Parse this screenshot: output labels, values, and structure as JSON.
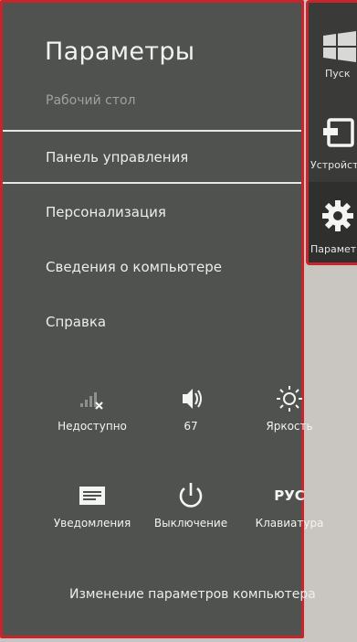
{
  "panel": {
    "title": "Параметры",
    "subtitle": "Рабочий стол",
    "menu": [
      {
        "label": "Панель управления"
      },
      {
        "label": "Персонализация"
      },
      {
        "label": "Сведения о компьютере"
      },
      {
        "label": "Справка"
      }
    ],
    "quick_settings": [
      {
        "label": "Недоступно",
        "icon": "network-unavailable-icon"
      },
      {
        "label": "67",
        "icon": "volume-icon"
      },
      {
        "label": "Яркость",
        "icon": "brightness-icon"
      },
      {
        "label": "Уведомления",
        "icon": "notifications-icon"
      },
      {
        "label": "Выключение",
        "icon": "power-icon"
      },
      {
        "label": "Клавиатура",
        "icon": "keyboard-icon",
        "icon_text": "РУС"
      }
    ],
    "footer_link": "Изменение параметров компьютера"
  },
  "charms": [
    {
      "label": "Пуск",
      "icon": "windows-start-icon"
    },
    {
      "label": "Устройства",
      "icon": "devices-icon"
    },
    {
      "label": "Параметры",
      "icon": "gear-icon",
      "selected": true
    }
  ],
  "colors": {
    "panel_bg": "#4f524e",
    "charms_bg": "#3a3b38",
    "highlight_border": "#c8242c",
    "text": "#ededeb"
  }
}
